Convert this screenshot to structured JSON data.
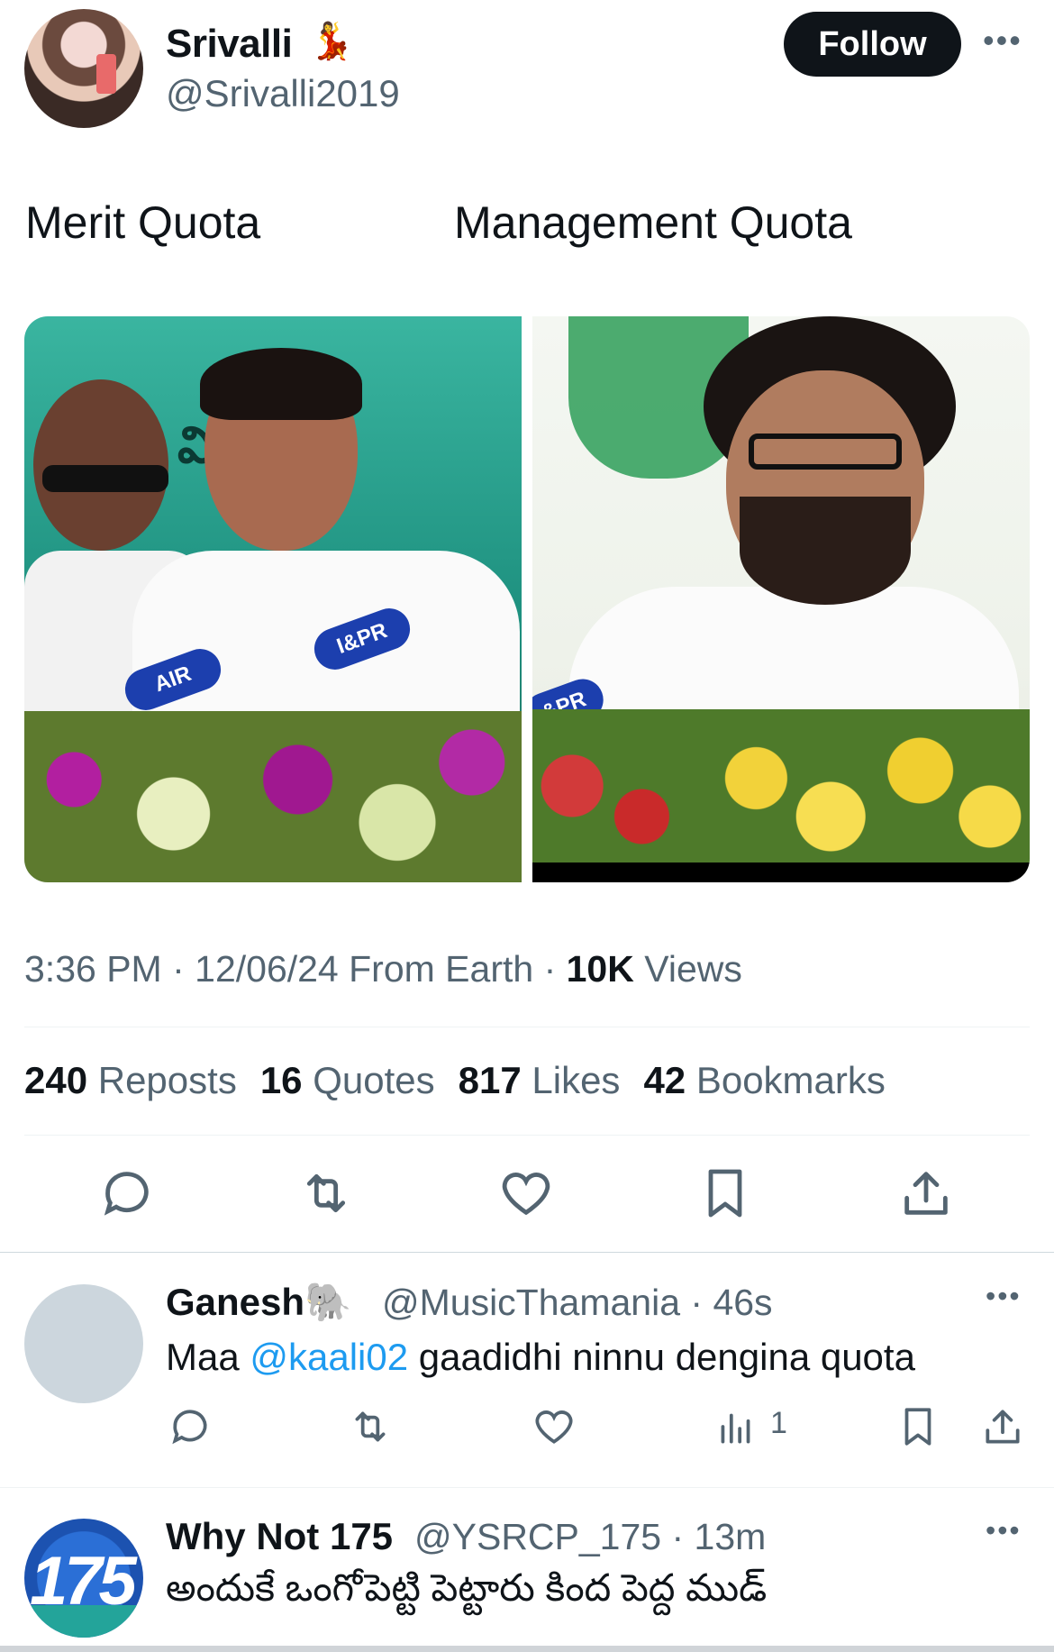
{
  "tweet": {
    "author_name": "Srivalli",
    "author_emoji": "💃",
    "author_handle": "@Srivalli2019",
    "follow_label": "Follow",
    "more_label": "•••",
    "text_left": "Merit Quota",
    "text_right": "Management Quota",
    "media": {
      "left_banner_text": "విలక",
      "left_mic_label_1": "AIR",
      "left_mic_label_2": "I&PR",
      "right_mic_label": "&PR"
    },
    "meta": {
      "time": "3:36 PM",
      "sep1": " · ",
      "date": "12/06/24",
      "location": " From Earth",
      "sep2": " · ",
      "views_count": "10K",
      "views_label": " Views"
    },
    "stats": [
      {
        "count": "240",
        "label": " Reposts"
      },
      {
        "count": "16",
        "label": " Quotes"
      },
      {
        "count": "817",
        "label": " Likes"
      },
      {
        "count": "42",
        "label": " Bookmarks"
      }
    ]
  },
  "replies": [
    {
      "name": "Ganesh",
      "emoji": "🐘",
      "handle": "@MusicThamania",
      "time": " · 46s",
      "text_prefix": "Maa ",
      "mention": "@kaali02",
      "text_suffix": " gaadidhi ninnu dengina quota",
      "views": "1",
      "more": "•••"
    },
    {
      "name": "Why Not 175",
      "handle": "@YSRCP_175",
      "time": " · 13m",
      "text": "అందుకే ఒంగోపెట్టి పెట్టారు కింద పెద్ద ముడ్",
      "avatar_text": "175",
      "more": "•••"
    }
  ],
  "icons": [
    "reply-icon",
    "repost-icon",
    "like-icon",
    "bookmark-icon",
    "share-icon",
    "views-icon",
    "more-icon"
  ],
  "colors": {
    "accent": "#1d9bf0",
    "text": "#0f1419",
    "muted": "#536471",
    "follow_bg": "#0f1419"
  }
}
